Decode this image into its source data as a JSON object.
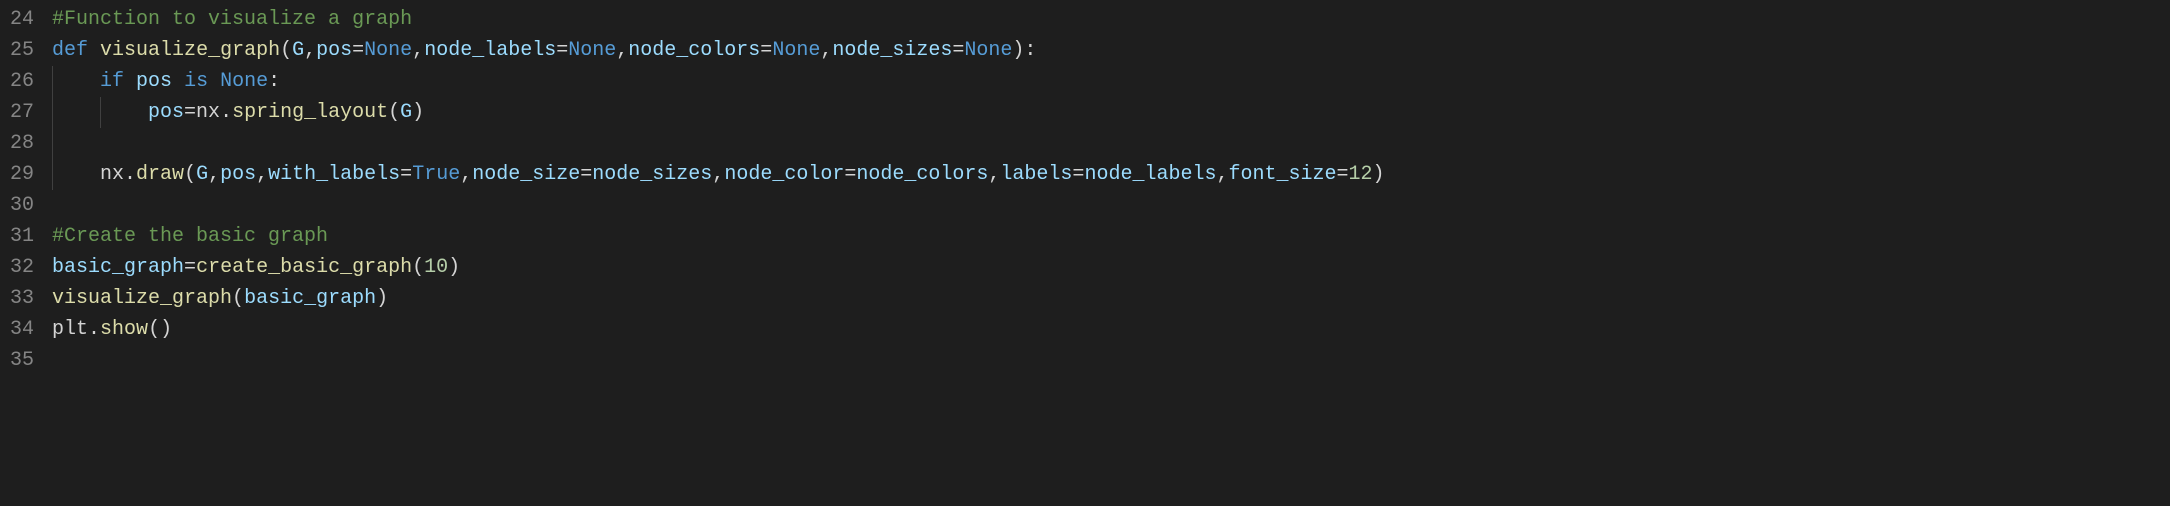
{
  "gutter": {
    "start": 24,
    "end": 35
  },
  "code": {
    "l24": {
      "comment": "#Function to visualize a graph"
    },
    "l25": {
      "kw_def": "def",
      "fn": "visualize_graph",
      "p_G": "G",
      "p_pos": "pos",
      "p_node_labels": "node_labels",
      "p_node_colors": "node_colors",
      "p_node_sizes": "node_sizes",
      "none": "None"
    },
    "l26": {
      "kw_if": "if",
      "var_pos": "pos",
      "kw_is": "is",
      "none": "None"
    },
    "l27": {
      "var_pos": "pos",
      "obj_nx": "nx",
      "fn_spring": "spring_layout",
      "arg_G": "G"
    },
    "l29": {
      "obj_nx": "nx",
      "fn_draw": "draw",
      "arg_G": "G",
      "arg_pos": "pos",
      "kw_with_labels": "with_labels",
      "val_true": "True",
      "kw_node_size": "node_size",
      "val_node_sizes": "node_sizes",
      "kw_node_color": "node_color",
      "val_node_colors": "node_colors",
      "kw_labels": "labels",
      "val_node_labels": "node_labels",
      "kw_font_size": "font_size",
      "val_12": "12"
    },
    "l31": {
      "comment": "#Create the basic graph"
    },
    "l32": {
      "var": "basic_graph",
      "fn": "create_basic_graph",
      "arg": "10"
    },
    "l33": {
      "fn": "visualize_graph",
      "arg": "basic_graph"
    },
    "l34": {
      "obj": "plt",
      "fn": "show"
    }
  }
}
